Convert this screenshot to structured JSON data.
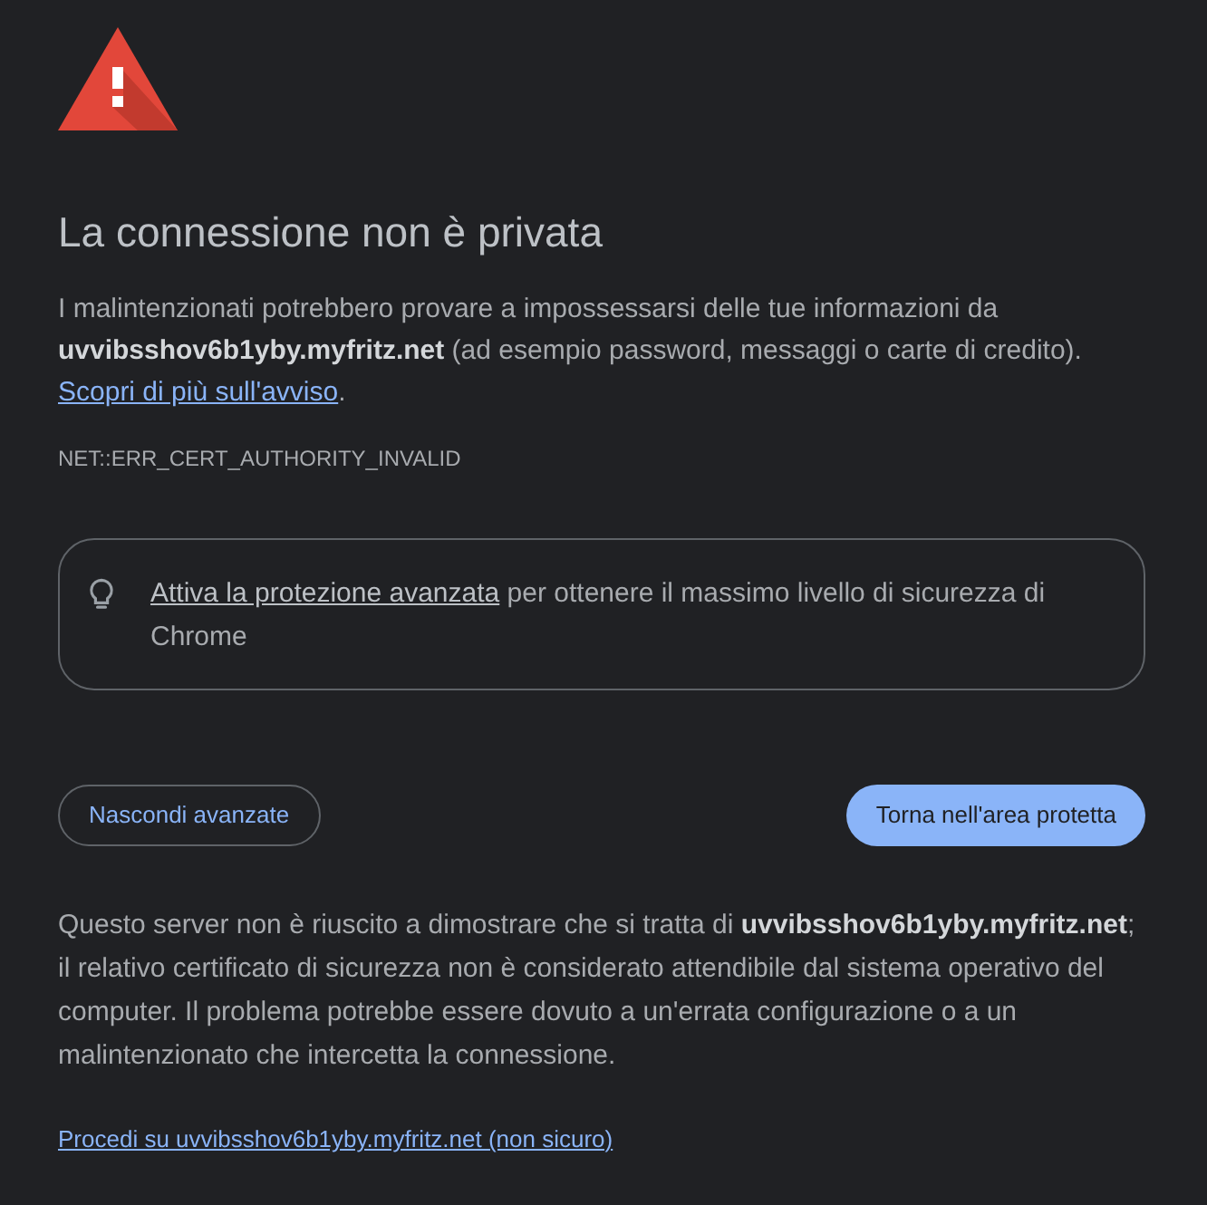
{
  "heading": "La connessione non è privata",
  "intro": {
    "text": "I malintenzionati potrebbero provare a impossessarsi delle tue informazioni da **uvvibsshov6b1yby.myfritz.net** (ad esempio password, messaggi o carte di credito).",
    "link": "Scopri di più sull'avviso",
    "after_link": "."
  },
  "error_code": "NET::ERR_CERT_AUTHORITY_INVALID",
  "protection_card": {
    "link": "Attiva la protezione avanzata",
    "text": "per ottenere il massimo livello di sicurezza di Chrome"
  },
  "buttons": [
    {
      "label": "Nascondi avanzate",
      "kind": "outline"
    },
    {
      "label": "Torna nell'area protetta",
      "kind": "primary"
    }
  ],
  "details": "Questo server non è riuscito a dimostrare che si tratta di **uvvibsshov6b1yby.myfritz.net**; il relativo certificato di sicurezza non è considerato attendibile dal sistema operativo del computer. Il problema potrebbe essere dovuto a un'errata configurazione o a un malintenzionato che intercetta la connessione.",
  "proceed_link": "Procedi su uvvibsshov6b1yby.myfritz.net (non sicuro)"
}
